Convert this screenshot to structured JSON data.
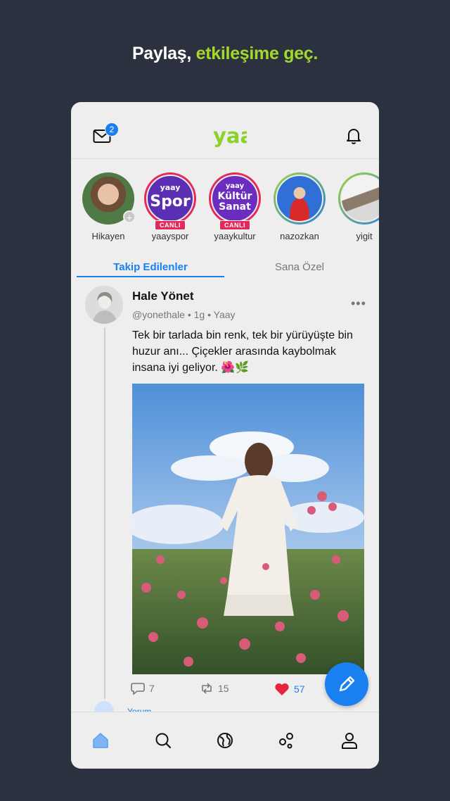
{
  "headline": {
    "part1": "Paylaş, ",
    "part2": "etkileşime geç."
  },
  "header": {
    "mail_badge": "2",
    "logo": "yaay"
  },
  "stories": [
    {
      "name": "Hikayen",
      "live": ""
    },
    {
      "name": "yaayspor",
      "live": "CANLI",
      "brand": "yaay",
      "title": "Spor"
    },
    {
      "name": "yaaykultur",
      "live": "CANLI",
      "brand": "yaay",
      "title1": "Kültür",
      "title2": "Sanat"
    },
    {
      "name": "nazozkan",
      "live": ""
    },
    {
      "name": "yigit",
      "live": ""
    }
  ],
  "tabs": {
    "following": "Takip Edilenler",
    "for_you": "Sana Özel"
  },
  "post": {
    "author": "Hale Yönet",
    "handle": "@yonethale",
    "time": "1g",
    "via": "Yaay",
    "meta_sep": "•",
    "more": "•••",
    "text": "Tek bir tarlada bin renk, tek bir yürüyüşte bin huzur anı... Çiçekler arasında kaybolmak insana iyi geliyor. 🌺🌿",
    "comments": "7",
    "reposts": "15",
    "likes": "57",
    "yorum": "Yorum"
  },
  "colors": {
    "accent": "#1a7ff0",
    "headline_accent": "#a4d82a",
    "like": "#e8243a"
  },
  "icons": [
    "mail-icon",
    "bell-icon",
    "comment-icon",
    "repost-icon",
    "heart-icon",
    "pencil-icon",
    "home-icon",
    "search-icon",
    "globe-icon",
    "discover-icon",
    "profile-icon"
  ]
}
